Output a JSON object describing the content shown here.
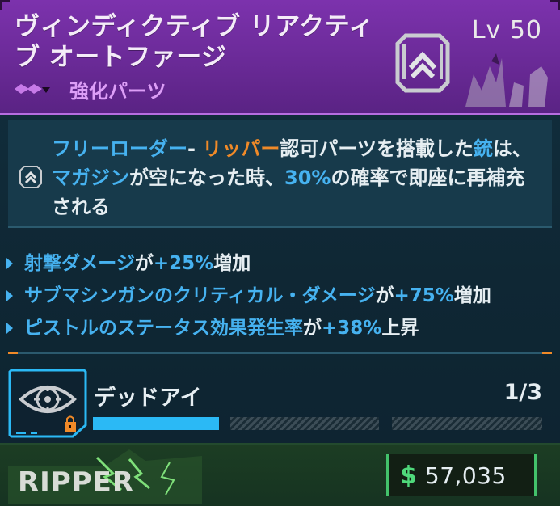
{
  "item": {
    "name": "ヴィンディクティブ リアクティブ オートファージ",
    "level": "Lv 50",
    "rarity_label": "強化パーツ"
  },
  "description": {
    "seg1": "フリーローダー",
    "seg2": "- ",
    "seg3": "リッパー",
    "seg4": "認可パーツを搭載した",
    "seg5": "銃",
    "seg6": "は、",
    "seg7": "マガジン",
    "seg8": "が空になった時、",
    "seg9": "30%",
    "seg10": "の確率で即座に再補充される"
  },
  "stats": [
    {
      "text": "射撃ダメージ",
      "mid": "が",
      "value": "+25%",
      "tail": "増加"
    },
    {
      "text": "サブマシンガンのクリティカル・ダメージ",
      "mid": "が",
      "value": "+75%",
      "tail": "増加"
    },
    {
      "text": "ピストルのステータス効果発生率",
      "mid": "が",
      "value": "+38%",
      "tail": "上昇"
    }
  ],
  "skill": {
    "name": "デッドアイ",
    "count": "1/3",
    "progress_filled_segments": 1,
    "progress_total_segments": 3
  },
  "footer": {
    "brand_logo_text": "RIPPER",
    "currency_symbol": "$",
    "price": "57,035"
  },
  "colors": {
    "rarity_purple": "#7c32ad",
    "highlight_blue": "#46b2f0",
    "highlight_orange": "#f08a28",
    "money_green": "#4fd97b"
  },
  "icons": {
    "manufacturer": "chevron-shield-icon",
    "skill": "eye-target-icon",
    "lock": "lock-icon",
    "rarity": "rarity-gem-icon"
  }
}
